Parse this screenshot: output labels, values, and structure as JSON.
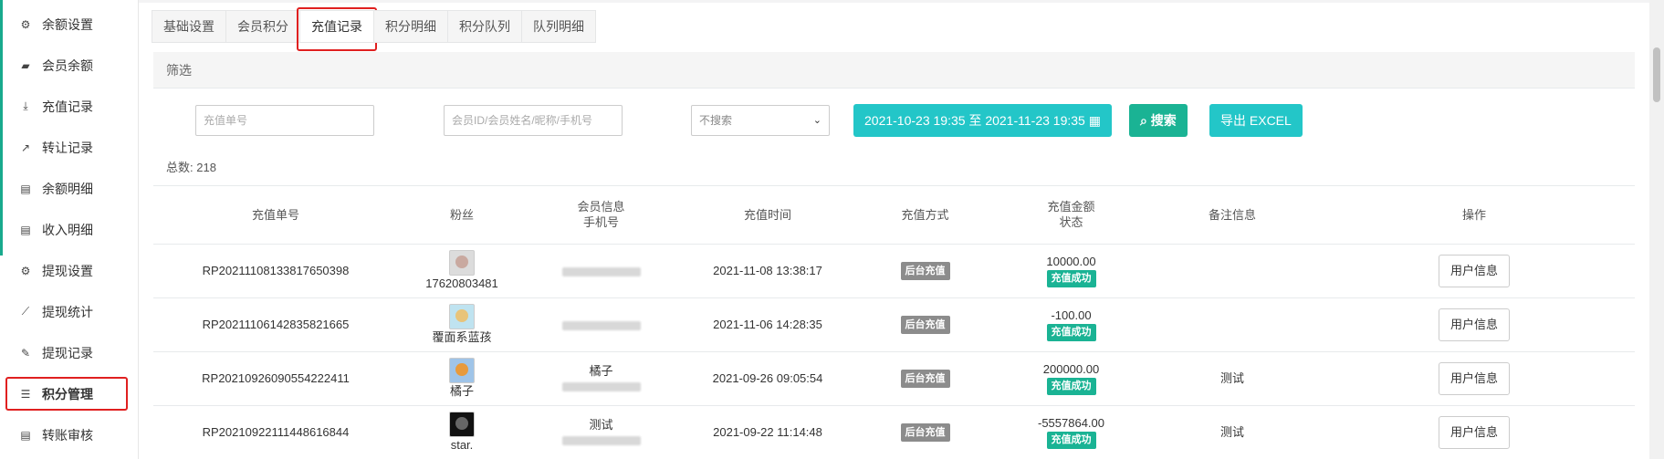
{
  "sidebar": {
    "items": [
      {
        "label": "余额设置",
        "icon": "gear-icon"
      },
      {
        "label": "会员余额",
        "icon": "book-icon"
      },
      {
        "label": "充值记录",
        "icon": "download-icon"
      },
      {
        "label": "转让记录",
        "icon": "external-link-icon"
      },
      {
        "label": "余额明细",
        "icon": "document-icon"
      },
      {
        "label": "收入明细",
        "icon": "document-icon"
      },
      {
        "label": "提现设置",
        "icon": "gear-icon"
      },
      {
        "label": "提现统计",
        "icon": "line-chart-icon"
      },
      {
        "label": "提现记录",
        "icon": "pencil-icon"
      },
      {
        "label": "积分管理",
        "icon": "database-icon",
        "active": true
      },
      {
        "label": "转账审核",
        "icon": "document-icon"
      }
    ]
  },
  "tabs": [
    "基础设置",
    "会员积分",
    "充值记录",
    "积分明细",
    "积分队列",
    "队列明细"
  ],
  "active_tab": "充值记录",
  "filter": {
    "title": "筛选",
    "order_placeholder": "充值单号",
    "member_placeholder": "会员ID/会员姓名/昵称/手机号",
    "select_value": "不搜索",
    "date_range": "2021-10-23 19:35 至 2021-11-23 19:35",
    "search_label": "搜索",
    "export_label": "导出 EXCEL"
  },
  "total": {
    "label": "总数:",
    "value": "218"
  },
  "table": {
    "headers": {
      "order": "充值单号",
      "fan": "粉丝",
      "member_1": "会员信息",
      "member_2": "手机号",
      "time": "充值时间",
      "method": "充值方式",
      "amount_1": "充值金额",
      "amount_2": "状态",
      "note": "备注信息",
      "action": "操作"
    },
    "rows": [
      {
        "order": "RP20211108133817650398",
        "fan": "17620803481",
        "member_name": "",
        "time": "2021-11-08 13:38:17",
        "method": "后台充值",
        "amount": "10000.00",
        "status": "充值成功",
        "note": "",
        "action": "用户信息",
        "avatar_color": "#c9a9a0"
      },
      {
        "order": "RP20211106142835821665",
        "fan": "覆面系蓝孩",
        "member_name": "",
        "time": "2021-11-06 14:28:35",
        "method": "后台充值",
        "amount": "-100.00",
        "status": "充值成功",
        "note": "",
        "action": "用户信息",
        "avatar_color": "#e8c47a"
      },
      {
        "order": "RP20210926090554222411",
        "fan": "橘子",
        "member_name": "橘子",
        "time": "2021-09-26 09:05:54",
        "method": "后台充值",
        "amount": "200000.00",
        "status": "充值成功",
        "note": "测试",
        "action": "用户信息",
        "avatar_color": "#e89a3c"
      },
      {
        "order": "RP20210922111448616844",
        "fan": "star.",
        "member_name": "测试",
        "time": "2021-09-22 11:14:48",
        "method": "后台充值",
        "amount": "-5557864.00",
        "status": "充值成功",
        "note": "测试",
        "action": "用户信息",
        "avatar_color": "#222222"
      }
    ]
  }
}
